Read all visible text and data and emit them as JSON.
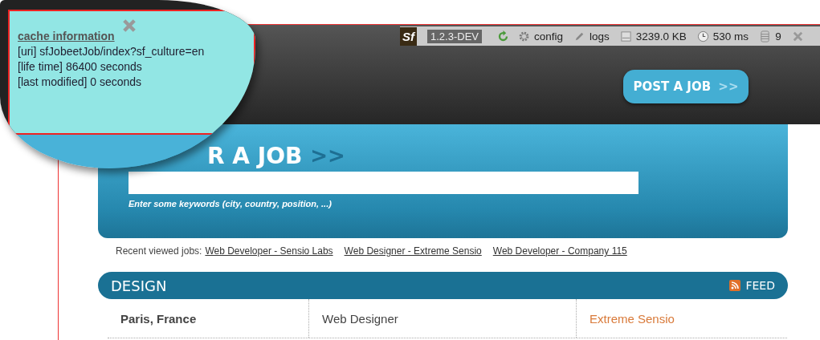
{
  "cache_info": {
    "title": "cache information",
    "lines": [
      "[uri] sfJobeetJob/index?sf_culture=en",
      "[life time] 86400 seconds",
      "[last modified] 0 seconds"
    ]
  },
  "debug_toolbar": {
    "logo": "Sf",
    "version": "1.2.3-DEV",
    "items": [
      {
        "kind": "config",
        "label": "config"
      },
      {
        "kind": "logs",
        "label": "logs"
      },
      {
        "kind": "memory",
        "label": "3239.0 KB"
      },
      {
        "kind": "time",
        "label": "530 ms"
      },
      {
        "kind": "database",
        "label": "9"
      }
    ]
  },
  "post_job_button": {
    "label": "POST A JOB",
    "arrows": ">>"
  },
  "search": {
    "heading": "R A JOB",
    "arrows": ">>",
    "hint": "Enter some keywords (city, country, position, ...)"
  },
  "recent": {
    "label": "Recent viewed jobs:",
    "links": [
      "Web Developer - Sensio Labs",
      "Web Designer - Extreme Sensio",
      "Web Developer - Company 115"
    ]
  },
  "category": {
    "name": "DESIGN",
    "feed": "FEED",
    "rows": [
      {
        "location": "Paris, France",
        "position": "Web Designer",
        "company": "Extreme Sensio"
      }
    ]
  }
}
